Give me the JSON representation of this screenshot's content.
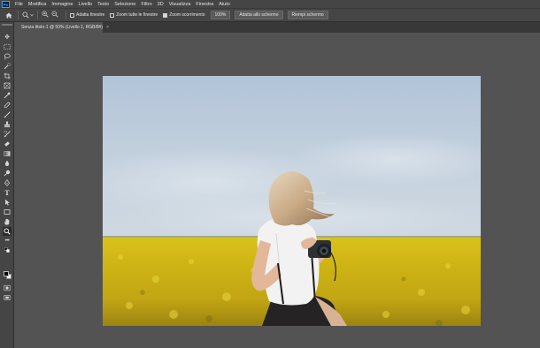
{
  "app": {
    "logo_text": "Ps"
  },
  "menu": [
    "File",
    "Modifica",
    "Immagine",
    "Livello",
    "Testo",
    "Selezione",
    "Filtro",
    "3D",
    "Visualizza",
    "Finestra",
    "Aiuto"
  ],
  "options_bar": {
    "checkbox_resize_windows": {
      "label": "Adatta finestre",
      "checked": false
    },
    "checkbox_zoom_all": {
      "label": "Zoom tutte le finestre",
      "checked": false
    },
    "checkbox_scrubby_zoom": {
      "label": "Zoom scorrimento",
      "checked": true
    },
    "btn_100": "100%",
    "btn_fit": "Adatta allo schermo",
    "btn_fill": "Riempi schermo"
  },
  "document_tab": {
    "title": "Senza titolo-1 @ 50% (Livello 1, RGB/8#)",
    "close": "×"
  },
  "tools": [
    "move-tool",
    "marquee-tool",
    "lasso-tool",
    "quick-selection-tool",
    "crop-tool",
    "frame-tool",
    "eyedropper-tool",
    "healing-brush-tool",
    "brush-tool",
    "clone-stamp-tool",
    "history-brush-tool",
    "eraser-tool",
    "gradient-tool",
    "blur-tool",
    "dodge-tool",
    "pen-tool",
    "type-tool",
    "path-selection-tool",
    "rectangle-tool",
    "hand-tool",
    "zoom-tool",
    "more-tools"
  ],
  "active_tool": "zoom-tool",
  "colors": {
    "foreground": "#000000",
    "background": "#ffffff",
    "canvas_bg": "#535353",
    "chrome": "#454545"
  }
}
